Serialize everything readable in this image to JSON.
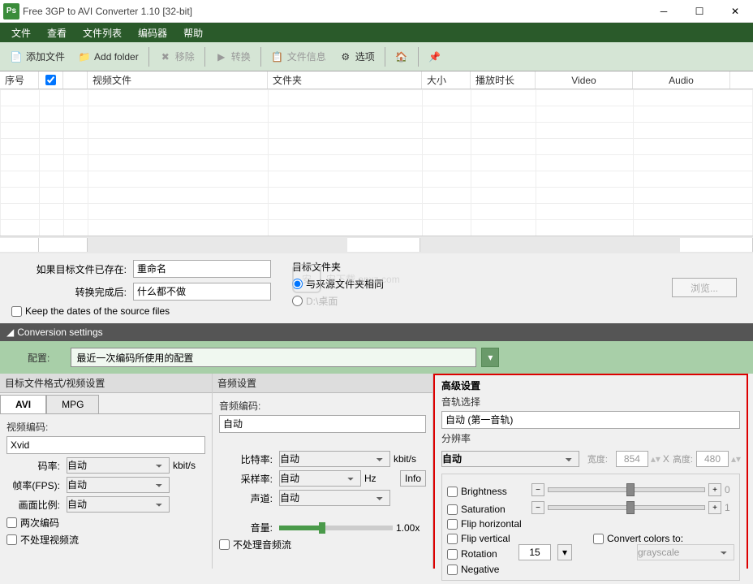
{
  "window": {
    "title": "Free 3GP to AVI Converter 1.10   [32-bit]",
    "icon_text": "Ps"
  },
  "menu": {
    "items": [
      "文件",
      "查看",
      "文件列表",
      "编码器",
      "帮助"
    ]
  },
  "toolbar": {
    "add_file": "添加文件",
    "add_folder": "Add folder",
    "remove": "移除",
    "convert": "转换",
    "file_info": "文件信息",
    "options": "选项"
  },
  "table": {
    "headers": {
      "index": "序号",
      "video_file": "视频文件",
      "folder": "文件夹",
      "size": "大小",
      "duration": "播放时长",
      "video": "Video",
      "audio": "Audio"
    }
  },
  "middle": {
    "if_exists_label": "如果目标文件已存在:",
    "if_exists_value": "重命名",
    "after_label": "转换完成后:",
    "after_value": "什么都不做",
    "dest_label": "目标文件夹",
    "same_as_source": "与来源文件夹相同",
    "desktop_path": "D:\\桌面",
    "browse": "浏览...",
    "keep_dates": "Keep the dates of the source files"
  },
  "conv": {
    "header": "Conversion settings"
  },
  "profile": {
    "label": "配置:",
    "value": "最近一次编码所使用的配置"
  },
  "video_settings": {
    "title": "目标文件格式/视频设置",
    "tabs": [
      "AVI",
      "MPG"
    ],
    "encoding_label": "视频编码:",
    "encoding_value": "Xvid",
    "bitrate_label": "码率:",
    "bitrate_value": "自动",
    "bitrate_unit": "kbit/s",
    "fps_label": "帧率(FPS):",
    "fps_value": "自动",
    "aspect_label": "画面比例:",
    "aspect_value": "自动",
    "two_pass": "两次编码",
    "no_video": "不处理视频流"
  },
  "audio_settings": {
    "title": "音频设置",
    "encoding_label": "音频编码:",
    "encoding_value": "自动",
    "bitrate_label": "比特率:",
    "bitrate_value": "自动",
    "bitrate_unit": "kbit/s",
    "sample_label": "采样率:",
    "sample_value": "自动",
    "sample_unit": "Hz",
    "channels_label": "声道:",
    "channels_value": "自动",
    "volume_label": "音量:",
    "volume_value": "1.00x",
    "no_audio": "不处理音频流",
    "info": "Info"
  },
  "advanced": {
    "title": "高级设置",
    "track_label": "音轨选择",
    "track_value": "自动 (第一音轨)",
    "resolution_label": "分辨率",
    "resolution_value": "自动",
    "width_label": "宽度:",
    "width_value": "854",
    "height_label": "高度:",
    "height_value": "480",
    "x": "X",
    "brightness": "Brightness",
    "brightness_val": "0",
    "saturation": "Saturation",
    "saturation_val": "1",
    "flip_h": "Flip horizontal",
    "flip_v": "Flip vertical",
    "rotation": "Rotation",
    "rotation_val": "15",
    "convert_colors": "Convert colors to:",
    "grayscale": "grayscale",
    "negative": "Negative"
  }
}
